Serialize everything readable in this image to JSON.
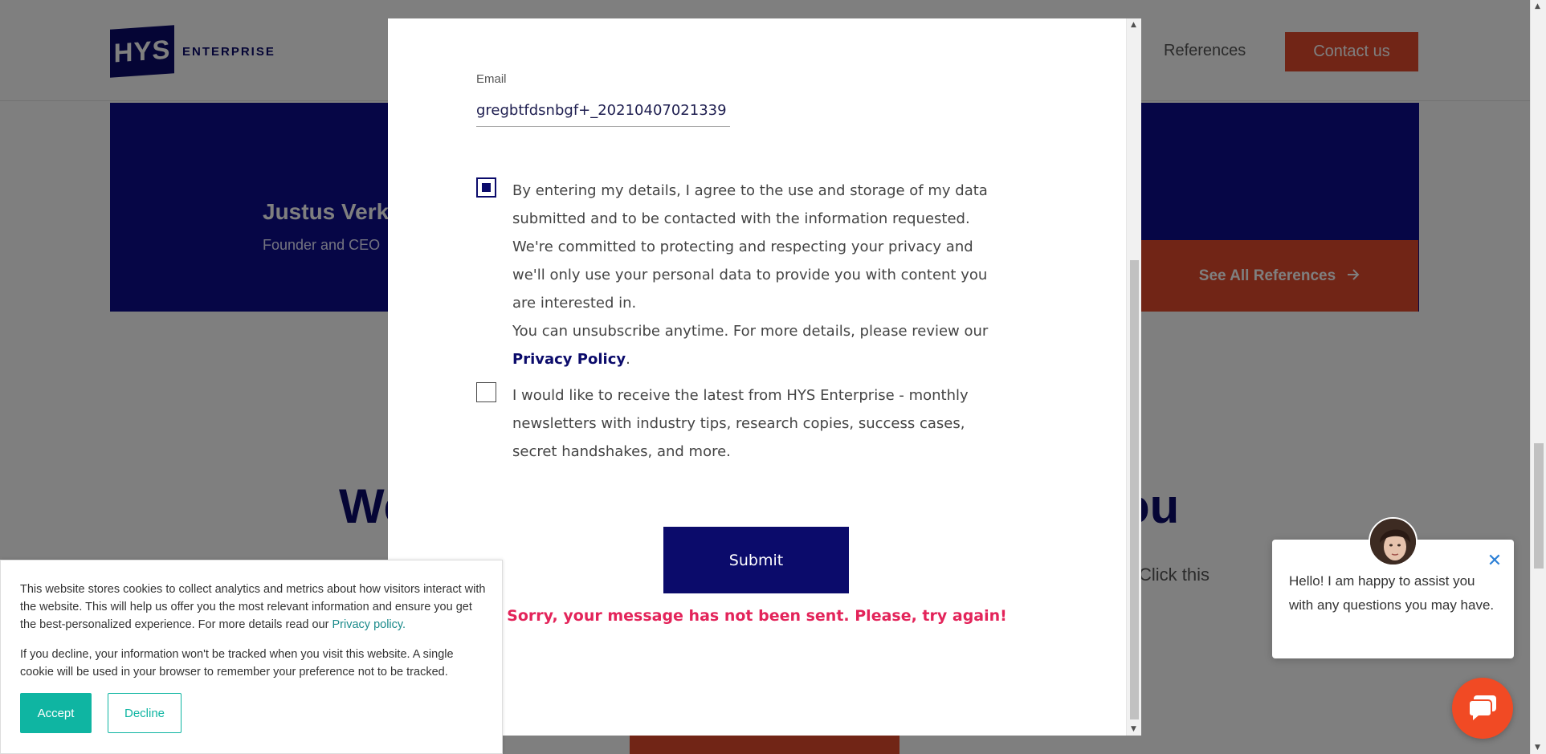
{
  "header": {
    "logo_mark": "HYS",
    "logo_word": "ENTERPRISE",
    "nav_references": "References",
    "contact_button": "Contact us"
  },
  "testimonial": {
    "name": "Justus Verk",
    "role": "Founder and CEO"
  },
  "references_button": "See All References",
  "section": {
    "heading_left": "We",
    "heading_right": "ou",
    "text_fragment": "Click this"
  },
  "modal": {
    "email_label": "Email",
    "email_value": "gregbtfdsnbgf+_20210407021339",
    "consent_checked": true,
    "consent_lines": [
      "By entering my details, I agree to the use and storage of my data submitted and to be contacted with the information requested.",
      "We're committed to protecting and respecting your privacy and we'll only use your personal data to provide you with content you are interested in.",
      "You can unsubscribe anytime. For more details, please review our"
    ],
    "privacy_link": "Privacy Policy",
    "privacy_suffix": ".",
    "newsletter_checked": false,
    "newsletter_text": "I would like to receive the latest from HYS Enterprise - monthly newsletters with industry tips, research copies, success cases, secret handshakes, and more.",
    "submit_label": "Submit",
    "error_message": "Sorry, your message has not been sent. Please, try again!"
  },
  "cookie_banner": {
    "text_1": "This website stores cookies to collect analytics and metrics about how visitors interact with the website. This will help us offer you the most relevant information and ensure you get the best-personalized experience. For more details read our",
    "privacy_link": "Privacy policy.",
    "text_2": "If you decline, your information won't be tracked when you visit this website. A single cookie will be used in your browser to remember your preference not to be tracked.",
    "accept_label": "Accept",
    "decline_label": "Decline"
  },
  "chat": {
    "message": "Hello! I am happy to assist you with any questions you may have.",
    "close_glyph": "✕"
  },
  "colors": {
    "brand_navy": "#0b0b6b",
    "brand_orange": "#e24a2c",
    "error_pink": "#e3245a",
    "cookie_teal": "#0fb5a2"
  }
}
